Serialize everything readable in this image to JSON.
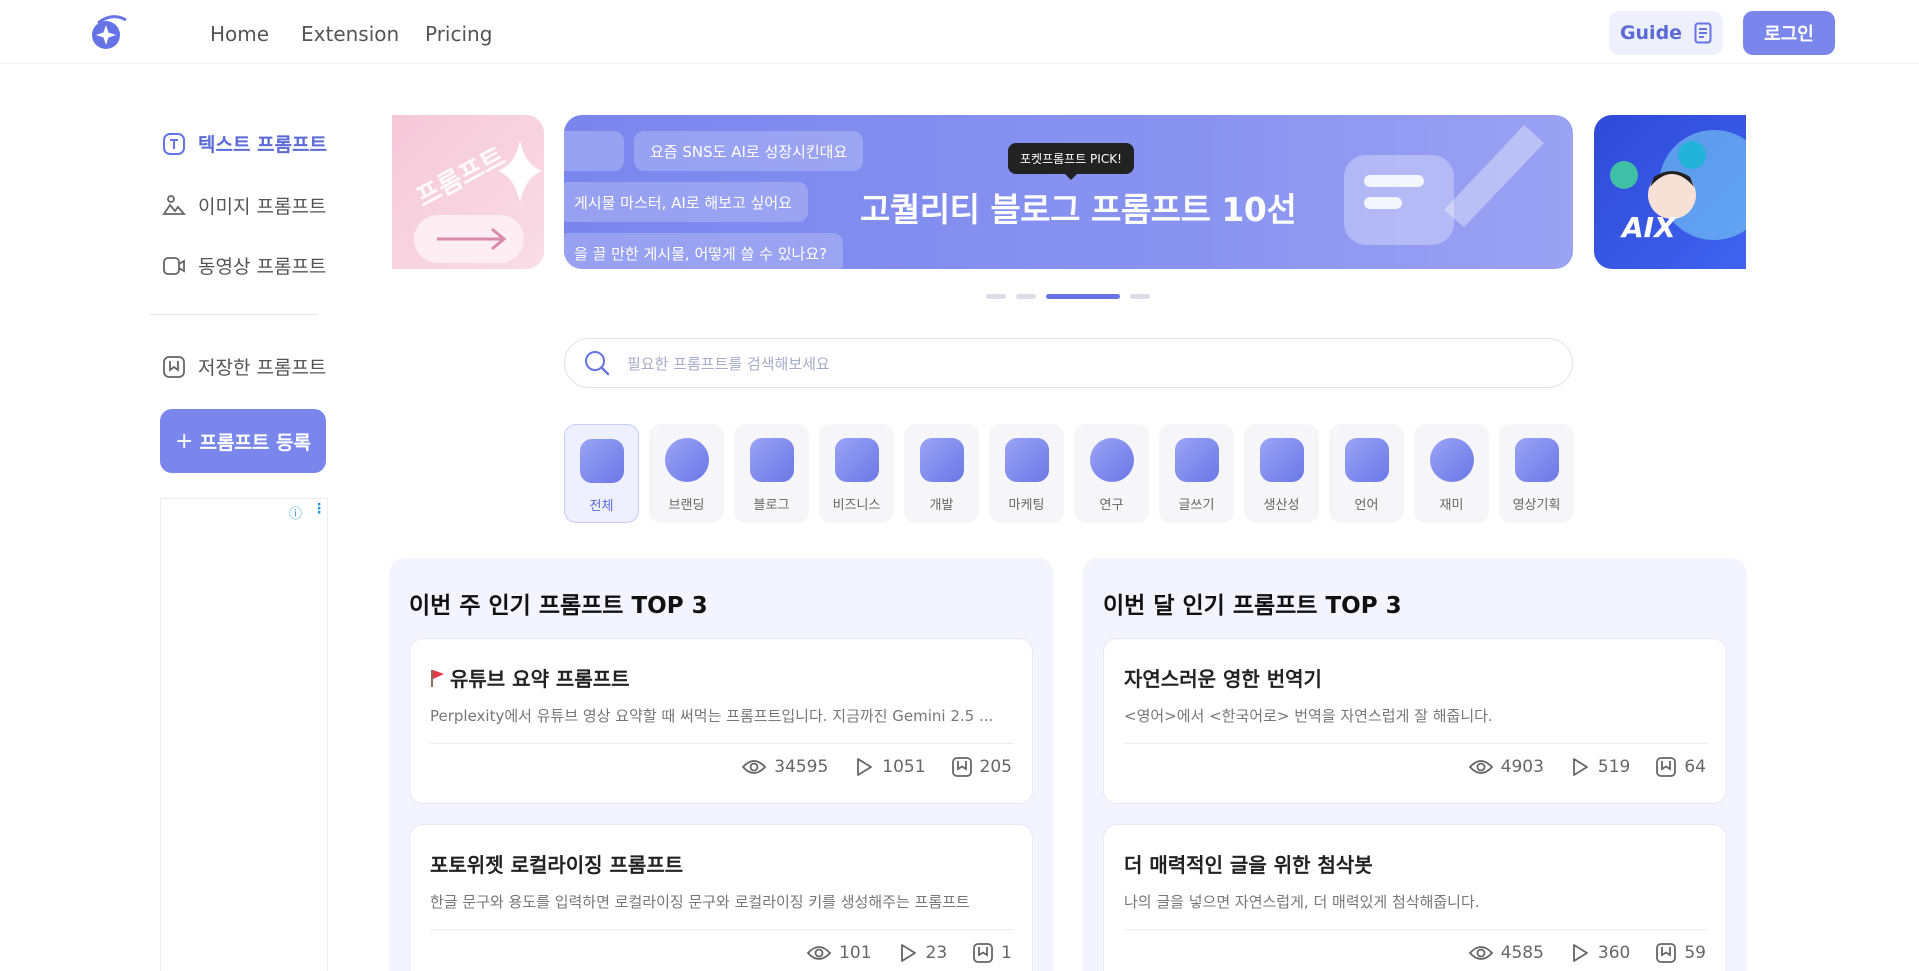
{
  "header": {
    "nav": [
      "Home",
      "Extension",
      "Pricing"
    ],
    "guide_label": "Guide",
    "login_label": "로그인"
  },
  "sidebar": {
    "items": [
      {
        "label": "텍스트 프롬프트",
        "icon": "text-icon",
        "active": true
      },
      {
        "label": "이미지 프롬프트",
        "icon": "image-icon",
        "active": false
      },
      {
        "label": "동영상 프롬프트",
        "icon": "video-icon",
        "active": false
      }
    ],
    "saved_label": "저장한 프롬프트",
    "register_label": "프롬프트 등록"
  },
  "banner": {
    "left_text": "프롬프트",
    "chips": [
      "요즘 SNS도 AI로 성장시킨대요",
      "게시물 마스터, AI로 해보고 싶어요",
      "을 끌 만한 게시물, 어떻게 쓸 수 있나요?"
    ],
    "pick_tag": "포켓프롬프트 PICK!",
    "title": "고퀄리티 블로그 프롬프트 10선",
    "right_text": "AIX",
    "dot_count": 4,
    "active_dot": 2
  },
  "search": {
    "placeholder": "필요한 프롬프트를 검색해보세요"
  },
  "categories": [
    {
      "label": "전체",
      "active": true
    },
    {
      "label": "브랜딩",
      "active": false
    },
    {
      "label": "블로그",
      "active": false
    },
    {
      "label": "비즈니스",
      "active": false
    },
    {
      "label": "개발",
      "active": false
    },
    {
      "label": "마케팅",
      "active": false
    },
    {
      "label": "연구",
      "active": false
    },
    {
      "label": "글쓰기",
      "active": false
    },
    {
      "label": "생산성",
      "active": false
    },
    {
      "label": "언어",
      "active": false
    },
    {
      "label": "재미",
      "active": false
    },
    {
      "label": "영상기획",
      "active": false
    }
  ],
  "weekly": {
    "title": "이번 주 인기 프롬프트 TOP 3",
    "cards": [
      {
        "title": "유튜브 요약 프롬프트",
        "flag": true,
        "desc": "Perplexity에서 유튜브 영상 요약할 때 써먹는 프롬프트입니다. 지금까진 Gemini 2.5 ...",
        "views": "34595",
        "uses": "1051",
        "saves": "205"
      },
      {
        "title": "포토위젯 로컬라이징 프롬프트",
        "flag": false,
        "desc": "한글 문구와 용도를 입력하면 로컬라이징 문구와 로컬라이징 키를 생성해주는 프롬프트",
        "views": "101",
        "uses": "23",
        "saves": "1"
      }
    ]
  },
  "monthly": {
    "title": "이번 달 인기 프롬프트 TOP 3",
    "cards": [
      {
        "title": "자연스러운 영한 번역기",
        "flag": false,
        "desc": "<영어>에서 <한국어로> 번역을 자연스럽게 잘 해줍니다.",
        "views": "4903",
        "uses": "519",
        "saves": "64"
      },
      {
        "title": "더 매력적인 글을 위한 첨삭봇",
        "flag": false,
        "desc": "나의 글을 넣으면 자연스럽게, 더 매력있게 첨삭해줍니다.",
        "views": "4585",
        "uses": "360",
        "saves": "59"
      }
    ]
  }
}
